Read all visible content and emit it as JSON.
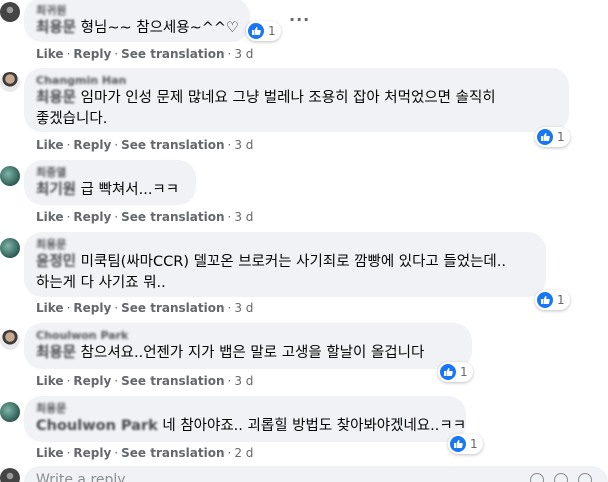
{
  "comments": [
    {
      "author": "최귀원",
      "mention": "최용문",
      "body": " 형님~~ 참으세용~^^♡",
      "reactions": "1",
      "actions": {
        "like": "Like",
        "reply": "Reply",
        "see_translation": "See translation",
        "time": "3 d"
      }
    },
    {
      "author": "Changmin Han",
      "mention": "최용문",
      "body_line1": " 임마가 인성 문제 많네요 그냥 벌레나 조용히 잡아 처먹었으면 솔직히",
      "body_line2": "좋겠습니다.",
      "reactions": "1",
      "actions": {
        "like": "Like",
        "reply": "Reply",
        "see_translation": "See translation",
        "time": "3 d"
      }
    },
    {
      "author": "최중열",
      "mention": "최기원",
      "body": " 급 빡쳐서...ㅋㅋ",
      "actions": {
        "like": "Like",
        "reply": "Reply",
        "see_translation": "See translation",
        "time": "3 d"
      }
    },
    {
      "author": "최용문",
      "mention": "윤정민",
      "body_line1": " 미쿡팀(싸마CCR) 델꼬온 브로커는 사기죄로 깜빵에 있다고 들었는데..",
      "body_line2": "하는게 다 사기죠 뭐..",
      "reactions": "1",
      "actions": {
        "like": "Like",
        "reply": "Reply",
        "see_translation": "See translation",
        "time": "3 d"
      }
    },
    {
      "author": "Choulwon Park",
      "mention": "최용문",
      "body": " 참으셔요..언젠가 지가 뱁은 말로 고생을 할날이 올겁니다",
      "reactions": "1",
      "actions": {
        "like": "Like",
        "reply": "Reply",
        "see_translation": "See translation",
        "time": "3 d"
      }
    },
    {
      "author": "최용문",
      "mention": "Choulwon Park",
      "body": " 네 참아야죠.. 괴롭힐 방법도 찾아봐야겠네요..ㅋㅋ",
      "reactions": "1",
      "actions": {
        "like": "Like",
        "reply": "Reply",
        "see_translation": "See translation",
        "time": "2 d"
      }
    }
  ],
  "more_options": "···",
  "write_placeholder": "Write a reply...",
  "colors": {
    "like_blue": "#1877f2",
    "bubble_bg": "#f0f2f5",
    "meta_text": "#65676b"
  }
}
